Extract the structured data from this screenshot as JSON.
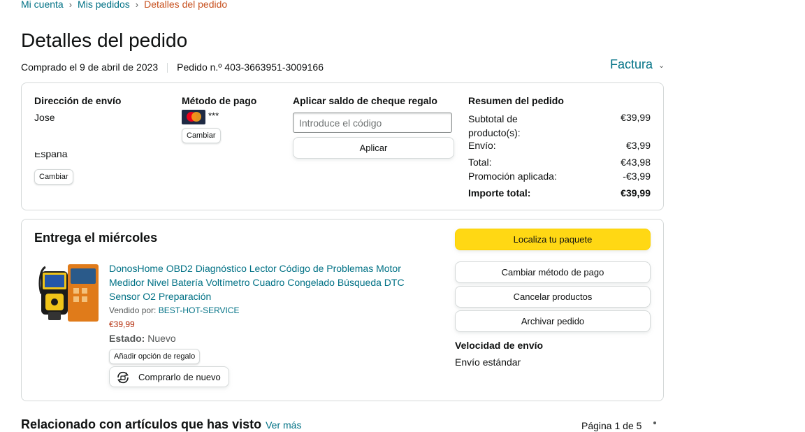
{
  "breadcrumb": {
    "items": [
      "Mi cuenta",
      "Mis pedidos"
    ],
    "current": "Detalles del pedido",
    "separator": "›"
  },
  "page": {
    "title": "Detalles del pedido",
    "purchased": "Comprado el 9 de abril de 2023",
    "order_number": "Pedido n.º 403-3663951-3009166",
    "invoice": "Factura"
  },
  "shipping": {
    "heading": "Dirección de envío",
    "name": "Jose",
    "country": "España",
    "change_label": "Cambiar"
  },
  "payment": {
    "heading": "Método de pago",
    "card_brand": "MasterCard",
    "card_mask": "***",
    "change_label": "Cambiar"
  },
  "gift": {
    "heading": "Aplicar saldo de cheque regalo",
    "placeholder": "Introduce el código",
    "apply_label": "Aplicar"
  },
  "summary": {
    "heading": "Resumen del pedido",
    "rows": [
      {
        "label": "Subtotal de producto(s):",
        "value": "€39,99"
      },
      {
        "label": "Envío:",
        "value": "€3,99"
      },
      {
        "label": "Total:",
        "value": "€43,98"
      },
      {
        "label": "Promoción aplicada:",
        "value": "-€3,99"
      }
    ],
    "grand_total_label": "Importe total:",
    "grand_total_value": "€39,99"
  },
  "delivery": {
    "heading": "Entrega el miércoles",
    "product_title": "DonosHome OBD2 Diagnóstico Lector Código de Problemas Motor Medidor Nivel Batería Voltímetro Cuadro Congelado Búsqueda DTC Sensor O2 Preparación",
    "sold_by_label": "Vendido por:",
    "seller": "BEST-HOT-SERVICE",
    "price": "€39,99",
    "condition_label": "Estado:",
    "condition_value": "Nuevo",
    "gift_option_label": "Añadir opción de regalo",
    "buy_again_label": "Comprarlo de nuevo"
  },
  "actions": {
    "track": "Localiza tu paquete",
    "change_payment": "Cambiar método de pago",
    "cancel": "Cancelar productos",
    "archive": "Archivar pedido",
    "speed_heading": "Velocidad de envío",
    "speed_value": "Envío estándar"
  },
  "related": {
    "heading": "Relacionado con artículos que has visto",
    "more": "Ver más",
    "pagination": "Página 1 de 5"
  },
  "colors": {
    "link": "#007185",
    "breadcrumb_current": "#c7511f",
    "price": "#b12704",
    "primary_button": "#ffd814",
    "border": "#d5d9d9"
  }
}
